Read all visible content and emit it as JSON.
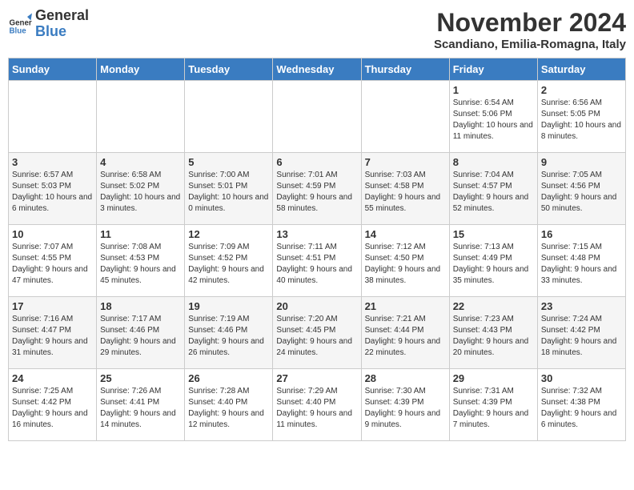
{
  "header": {
    "logo_line1": "General",
    "logo_line2": "Blue",
    "month_title": "November 2024",
    "subtitle": "Scandiano, Emilia-Romagna, Italy"
  },
  "days_of_week": [
    "Sunday",
    "Monday",
    "Tuesday",
    "Wednesday",
    "Thursday",
    "Friday",
    "Saturday"
  ],
  "weeks": [
    [
      {
        "day": "",
        "info": ""
      },
      {
        "day": "",
        "info": ""
      },
      {
        "day": "",
        "info": ""
      },
      {
        "day": "",
        "info": ""
      },
      {
        "day": "",
        "info": ""
      },
      {
        "day": "1",
        "info": "Sunrise: 6:54 AM\nSunset: 5:06 PM\nDaylight: 10 hours and 11 minutes."
      },
      {
        "day": "2",
        "info": "Sunrise: 6:56 AM\nSunset: 5:05 PM\nDaylight: 10 hours and 8 minutes."
      }
    ],
    [
      {
        "day": "3",
        "info": "Sunrise: 6:57 AM\nSunset: 5:03 PM\nDaylight: 10 hours and 6 minutes."
      },
      {
        "day": "4",
        "info": "Sunrise: 6:58 AM\nSunset: 5:02 PM\nDaylight: 10 hours and 3 minutes."
      },
      {
        "day": "5",
        "info": "Sunrise: 7:00 AM\nSunset: 5:01 PM\nDaylight: 10 hours and 0 minutes."
      },
      {
        "day": "6",
        "info": "Sunrise: 7:01 AM\nSunset: 4:59 PM\nDaylight: 9 hours and 58 minutes."
      },
      {
        "day": "7",
        "info": "Sunrise: 7:03 AM\nSunset: 4:58 PM\nDaylight: 9 hours and 55 minutes."
      },
      {
        "day": "8",
        "info": "Sunrise: 7:04 AM\nSunset: 4:57 PM\nDaylight: 9 hours and 52 minutes."
      },
      {
        "day": "9",
        "info": "Sunrise: 7:05 AM\nSunset: 4:56 PM\nDaylight: 9 hours and 50 minutes."
      }
    ],
    [
      {
        "day": "10",
        "info": "Sunrise: 7:07 AM\nSunset: 4:55 PM\nDaylight: 9 hours and 47 minutes."
      },
      {
        "day": "11",
        "info": "Sunrise: 7:08 AM\nSunset: 4:53 PM\nDaylight: 9 hours and 45 minutes."
      },
      {
        "day": "12",
        "info": "Sunrise: 7:09 AM\nSunset: 4:52 PM\nDaylight: 9 hours and 42 minutes."
      },
      {
        "day": "13",
        "info": "Sunrise: 7:11 AM\nSunset: 4:51 PM\nDaylight: 9 hours and 40 minutes."
      },
      {
        "day": "14",
        "info": "Sunrise: 7:12 AM\nSunset: 4:50 PM\nDaylight: 9 hours and 38 minutes."
      },
      {
        "day": "15",
        "info": "Sunrise: 7:13 AM\nSunset: 4:49 PM\nDaylight: 9 hours and 35 minutes."
      },
      {
        "day": "16",
        "info": "Sunrise: 7:15 AM\nSunset: 4:48 PM\nDaylight: 9 hours and 33 minutes."
      }
    ],
    [
      {
        "day": "17",
        "info": "Sunrise: 7:16 AM\nSunset: 4:47 PM\nDaylight: 9 hours and 31 minutes."
      },
      {
        "day": "18",
        "info": "Sunrise: 7:17 AM\nSunset: 4:46 PM\nDaylight: 9 hours and 29 minutes."
      },
      {
        "day": "19",
        "info": "Sunrise: 7:19 AM\nSunset: 4:46 PM\nDaylight: 9 hours and 26 minutes."
      },
      {
        "day": "20",
        "info": "Sunrise: 7:20 AM\nSunset: 4:45 PM\nDaylight: 9 hours and 24 minutes."
      },
      {
        "day": "21",
        "info": "Sunrise: 7:21 AM\nSunset: 4:44 PM\nDaylight: 9 hours and 22 minutes."
      },
      {
        "day": "22",
        "info": "Sunrise: 7:23 AM\nSunset: 4:43 PM\nDaylight: 9 hours and 20 minutes."
      },
      {
        "day": "23",
        "info": "Sunrise: 7:24 AM\nSunset: 4:42 PM\nDaylight: 9 hours and 18 minutes."
      }
    ],
    [
      {
        "day": "24",
        "info": "Sunrise: 7:25 AM\nSunset: 4:42 PM\nDaylight: 9 hours and 16 minutes."
      },
      {
        "day": "25",
        "info": "Sunrise: 7:26 AM\nSunset: 4:41 PM\nDaylight: 9 hours and 14 minutes."
      },
      {
        "day": "26",
        "info": "Sunrise: 7:28 AM\nSunset: 4:40 PM\nDaylight: 9 hours and 12 minutes."
      },
      {
        "day": "27",
        "info": "Sunrise: 7:29 AM\nSunset: 4:40 PM\nDaylight: 9 hours and 11 minutes."
      },
      {
        "day": "28",
        "info": "Sunrise: 7:30 AM\nSunset: 4:39 PM\nDaylight: 9 hours and 9 minutes."
      },
      {
        "day": "29",
        "info": "Sunrise: 7:31 AM\nSunset: 4:39 PM\nDaylight: 9 hours and 7 minutes."
      },
      {
        "day": "30",
        "info": "Sunrise: 7:32 AM\nSunset: 4:38 PM\nDaylight: 9 hours and 6 minutes."
      }
    ]
  ]
}
